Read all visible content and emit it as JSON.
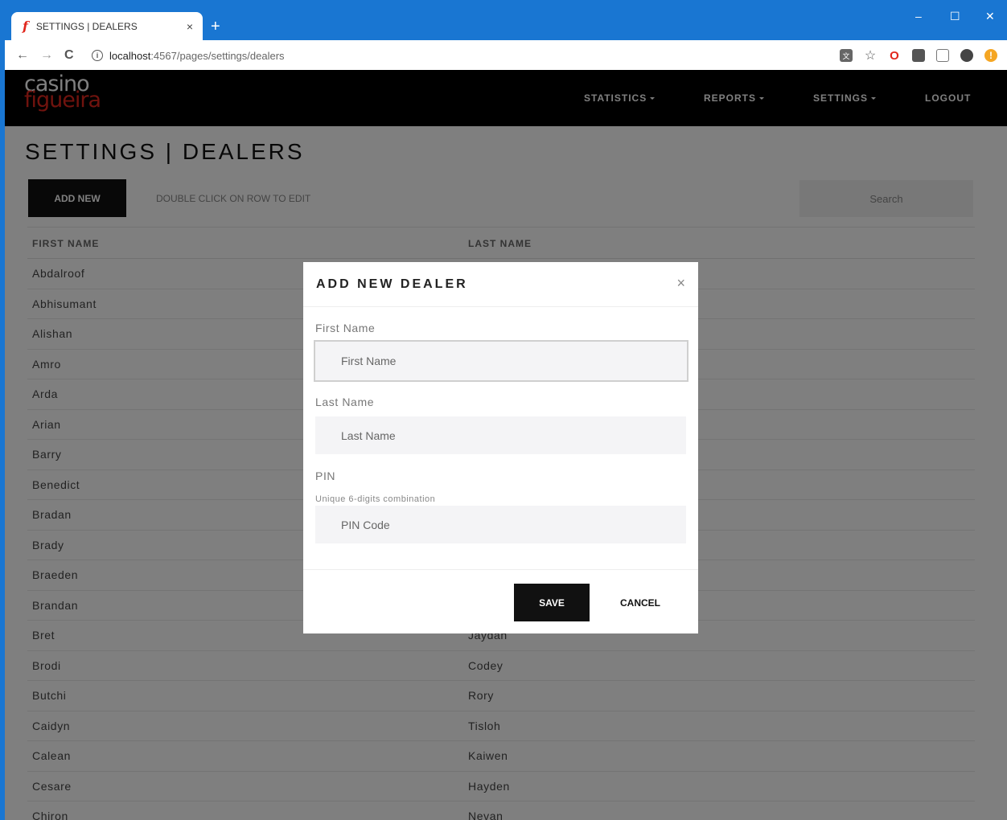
{
  "browser": {
    "tab_title": "SETTINGS | DEALERS",
    "tab_favicon": "f",
    "tab_close": "×",
    "new_tab": "+",
    "url_host": "localhost",
    "url_path": ":4567/pages/settings/dealers",
    "window_controls": {
      "minimize": "–",
      "maximize": "☐",
      "close": "✕"
    },
    "nav": {
      "back": "←",
      "forward": "→",
      "reload": "C"
    },
    "info_icon": "i"
  },
  "header": {
    "logo_line1": "casino",
    "logo_line2": "figueira",
    "nav_items": [
      "STATISTICS",
      "REPORTS",
      "SETTINGS",
      "LOGOUT"
    ]
  },
  "page": {
    "title": "SETTINGS | DEALERS",
    "add_new_label": "ADD NEW",
    "hint": "DOUBLE CLICK ON ROW TO EDIT",
    "search_placeholder": "Search"
  },
  "table": {
    "headers": [
      "FIRST NAME",
      "LAST NAME"
    ],
    "rows": [
      {
        "first": "Abdalroof",
        "last": ""
      },
      {
        "first": "Abhisumant",
        "last": ""
      },
      {
        "first": "Alishan",
        "last": ""
      },
      {
        "first": "Amro",
        "last": ""
      },
      {
        "first": "Arda",
        "last": ""
      },
      {
        "first": "Arian",
        "last": ""
      },
      {
        "first": "Barry",
        "last": ""
      },
      {
        "first": "Benedict",
        "last": ""
      },
      {
        "first": "Bradan",
        "last": ""
      },
      {
        "first": "Brady",
        "last": ""
      },
      {
        "first": "Braeden",
        "last": ""
      },
      {
        "first": "Brandan",
        "last": ""
      },
      {
        "first": "Bret",
        "last": "Jaydan"
      },
      {
        "first": "Brodi",
        "last": "Codey"
      },
      {
        "first": "Butchi",
        "last": "Rory"
      },
      {
        "first": "Caidyn",
        "last": "Tisloh"
      },
      {
        "first": "Calean",
        "last": "Kaiwen"
      },
      {
        "first": "Cesare",
        "last": "Hayden"
      },
      {
        "first": "Chiron",
        "last": "Nevan"
      }
    ]
  },
  "modal": {
    "title": "ADD NEW DEALER",
    "close": "×",
    "first_name_label": "First Name",
    "first_name_placeholder": "First Name",
    "last_name_label": "Last Name",
    "last_name_placeholder": "Last Name",
    "pin_label": "PIN",
    "pin_help": "Unique 6-digits combination",
    "pin_placeholder": "PIN Code",
    "save_label": "SAVE",
    "cancel_label": "CANCEL"
  },
  "colors": {
    "chrome": "#1976d2",
    "navbar": "#000000",
    "brand_red": "#e1261c",
    "button_dark": "#111111"
  }
}
